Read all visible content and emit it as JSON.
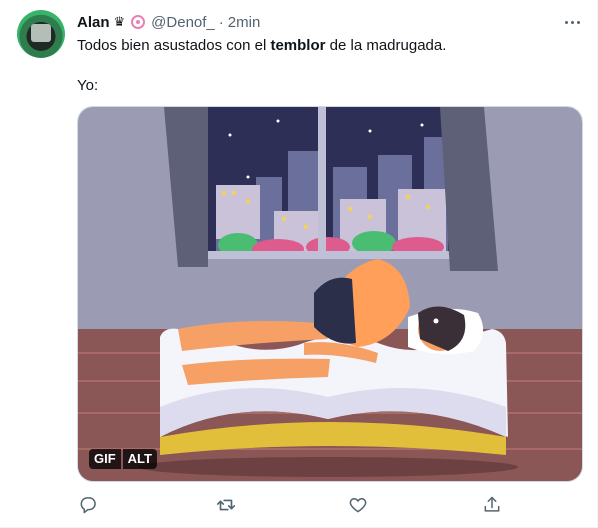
{
  "tweet": {
    "author": {
      "name": "Alan",
      "badge_glyph": "♛",
      "handle": "@Denof_",
      "separator": "·",
      "time": "2min"
    },
    "text_before": "Todos bien asustados con el ",
    "text_bold": "temblor",
    "text_after": " de la madrugada.",
    "text_line2": "Yo:",
    "media": {
      "gif_label": "GIF",
      "alt_label": "ALT"
    },
    "icons": {
      "more": "more-options-icon",
      "reply": "reply-icon",
      "retweet": "retweet-icon",
      "like": "like-icon",
      "share": "share-icon"
    },
    "colors": {
      "secondary_text": "#536471",
      "border": "#cfd9de",
      "accent_pink": "#e880b6"
    }
  }
}
